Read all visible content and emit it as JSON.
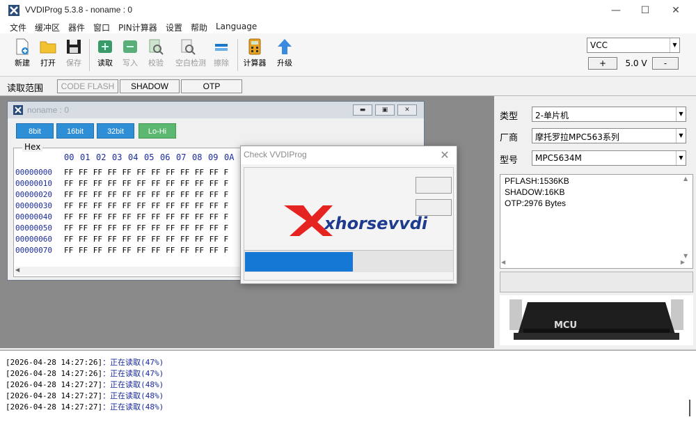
{
  "window": {
    "title": "VVDIProg 5.3.8 - noname : 0",
    "minimize": "—",
    "maximize": "☐",
    "close": "✕"
  },
  "menu": [
    "文件",
    "缓冲区",
    "器件",
    "窗口",
    "PIN计算器",
    "设置",
    "帮助",
    "Language"
  ],
  "toolbar": {
    "new": "新建",
    "open": "打开",
    "save": "保存",
    "read": "读取",
    "write": "写入",
    "verify": "校验",
    "blank_check": "空白检测",
    "erase": "擦除",
    "calculator": "计算器",
    "upgrade": "升级"
  },
  "power": {
    "vcc_label": "VCC",
    "plus": "+",
    "voltage": "5.0 V",
    "minus": "-"
  },
  "read_range": {
    "label": "读取范围",
    "buttons": [
      "CODE FLASH",
      "SHADOW",
      "OTP"
    ]
  },
  "child_window": {
    "title": "noname : 0",
    "bit_buttons": [
      "8bit",
      "16bit",
      "32bit",
      "Lo-Hi"
    ],
    "hex_label": "Hex",
    "columns": [
      "00",
      "01",
      "02",
      "03",
      "04",
      "05",
      "06",
      "07",
      "08",
      "09",
      "0A",
      "0"
    ],
    "addresses": [
      "00000000",
      "00000010",
      "00000020",
      "00000030",
      "00000040",
      "00000050",
      "00000060",
      "00000070"
    ],
    "row_bytes": "FF FF FF FF FF FF FF FF FF FF FF F"
  },
  "dialog": {
    "title": "Check VVDIProg",
    "close": "✕",
    "progress": 0.52,
    "logo_text": "xhorsevvdi"
  },
  "device": {
    "type_label": "类型",
    "type_value": "2-单片机",
    "maker_label": "厂商",
    "maker_value": "摩托罗拉MPC563系列",
    "model_label": "型号",
    "model_value": "MPC5634M",
    "info": [
      "PFLASH:1536KB",
      "SHADOW:16KB",
      "OTP:2976 Bytes"
    ],
    "chip_text": "MCU"
  },
  "log": [
    {
      "ts": "[2026-04-28 14:27:26]",
      "msg": "：正在读取(47%)"
    },
    {
      "ts": "[2026-04-28 14:27:26]",
      "msg": "：正在读取(47%)"
    },
    {
      "ts": "[2026-04-28 14:27:27]",
      "msg": "：正在读取(48%)"
    },
    {
      "ts": "[2026-04-28 14:27:27]",
      "msg": "：正在读取(48%)"
    },
    {
      "ts": "[2026-04-28 14:27:27]",
      "msg": "：正在读取(48%)"
    }
  ],
  "colors": {
    "accent": "#1478d4",
    "bit_button": "#2f8fd6",
    "lohi_button": "#5cb870",
    "hex_text": "#1a2aa0",
    "logo_red": "#e52421",
    "logo_blue": "#1f3b8f"
  }
}
